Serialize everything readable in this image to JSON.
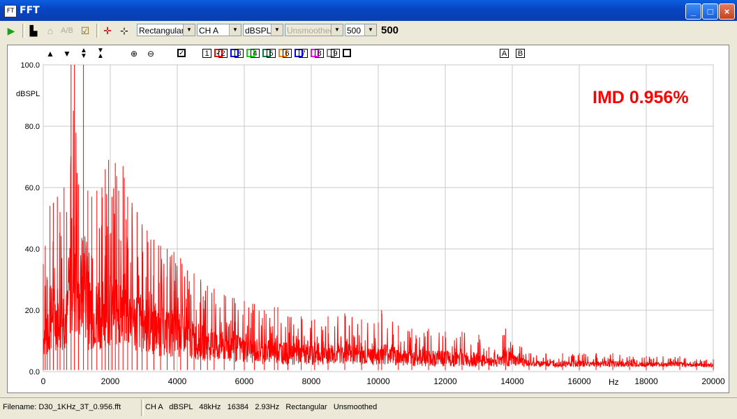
{
  "window": {
    "title": "FFT",
    "app_icon": "fft-app-icon"
  },
  "toolbar": {
    "play_icon": "play-icon",
    "window_type": "Rectangular",
    "channel": "CH A",
    "units": "dBSPL",
    "smoothing": "Unsmoothed",
    "averages": "500",
    "averages_display": "500"
  },
  "plot_toolbar": {
    "trace_numbers": [
      "1",
      "2",
      "3",
      "4",
      "5",
      "6",
      "7",
      "8",
      "9"
    ],
    "trace_colors": [
      "#ff0000",
      "#0000ff",
      "#00e000",
      "#008040",
      "#ff8000",
      "#0000ff",
      "#ff00ff",
      "#808080",
      "#000000"
    ],
    "trace1_checked": true,
    "letters": [
      "A",
      "B"
    ]
  },
  "chart_data": {
    "type": "line",
    "annotation": "IMD 0.956%",
    "annotation_color": "#ff0000",
    "series_color": "#ff0000",
    "ylabel": "dBSPL",
    "xlabel": "Hz",
    "xlim": [
      0,
      20000
    ],
    "ylim": [
      0,
      100
    ],
    "xticks": [
      "0",
      "2000",
      "4000",
      "6000",
      "8000",
      "10000",
      "12000",
      "14000",
      "16000",
      "18000",
      "20000"
    ],
    "xtick_values": [
      0,
      2000,
      4000,
      6000,
      8000,
      10000,
      12000,
      14000,
      16000,
      18000,
      20000
    ],
    "yticks": [
      "0.0",
      "20.0",
      "40.0",
      "60.0",
      "80.0",
      "100.0"
    ],
    "ytick_values": [
      0,
      20,
      40,
      60,
      80,
      100
    ],
    "grid": true,
    "peaks": [
      {
        "x": 0,
        "y": 35
      },
      {
        "x": 60,
        "y": 41
      },
      {
        "x": 120,
        "y": 30
      },
      {
        "x": 200,
        "y": 54
      },
      {
        "x": 300,
        "y": 55
      },
      {
        "x": 420,
        "y": 57
      },
      {
        "x": 500,
        "y": 52
      },
      {
        "x": 620,
        "y": 60
      },
      {
        "x": 700,
        "y": 52
      },
      {
        "x": 830,
        "y": 100
      },
      {
        "x": 930,
        "y": 100
      },
      {
        "x": 1050,
        "y": 61
      },
      {
        "x": 1200,
        "y": 100
      },
      {
        "x": 1330,
        "y": 59
      },
      {
        "x": 1450,
        "y": 57
      },
      {
        "x": 1600,
        "y": 59
      },
      {
        "x": 1750,
        "y": 60
      },
      {
        "x": 1850,
        "y": 66
      },
      {
        "x": 1950,
        "y": 69
      },
      {
        "x": 2050,
        "y": 57
      },
      {
        "x": 2150,
        "y": 68
      },
      {
        "x": 2250,
        "y": 59
      },
      {
        "x": 2380,
        "y": 67
      },
      {
        "x": 2520,
        "y": 57
      },
      {
        "x": 2650,
        "y": 55
      },
      {
        "x": 2800,
        "y": 52
      },
      {
        "x": 2950,
        "y": 48
      },
      {
        "x": 3100,
        "y": 46
      },
      {
        "x": 3300,
        "y": 43
      },
      {
        "x": 3500,
        "y": 41
      },
      {
        "x": 3700,
        "y": 40
      },
      {
        "x": 3900,
        "y": 39
      },
      {
        "x": 4100,
        "y": 37
      },
      {
        "x": 4300,
        "y": 33
      },
      {
        "x": 4500,
        "y": 32
      },
      {
        "x": 4700,
        "y": 30
      },
      {
        "x": 4900,
        "y": 28
      },
      {
        "x": 5100,
        "y": 27
      },
      {
        "x": 5400,
        "y": 25
      },
      {
        "x": 5700,
        "y": 24
      },
      {
        "x": 6000,
        "y": 23
      },
      {
        "x": 6300,
        "y": 22
      },
      {
        "x": 6600,
        "y": 20
      },
      {
        "x": 6900,
        "y": 21
      },
      {
        "x": 7000,
        "y": 21
      },
      {
        "x": 7300,
        "y": 18
      },
      {
        "x": 7700,
        "y": 18
      },
      {
        "x": 8100,
        "y": 17
      },
      {
        "x": 8500,
        "y": 18
      },
      {
        "x": 9000,
        "y": 19
      },
      {
        "x": 9500,
        "y": 17
      },
      {
        "x": 10000,
        "y": 16
      },
      {
        "x": 10100,
        "y": 20
      },
      {
        "x": 10600,
        "y": 15
      },
      {
        "x": 11000,
        "y": 14
      },
      {
        "x": 11500,
        "y": 14
      },
      {
        "x": 12000,
        "y": 13
      },
      {
        "x": 12500,
        "y": 13
      },
      {
        "x": 13000,
        "y": 12
      },
      {
        "x": 13300,
        "y": 8
      },
      {
        "x": 13800,
        "y": 14
      },
      {
        "x": 14500,
        "y": 6
      },
      {
        "x": 15000,
        "y": 6
      },
      {
        "x": 15500,
        "y": 6
      },
      {
        "x": 16000,
        "y": 6
      },
      {
        "x": 16500,
        "y": 6
      },
      {
        "x": 17000,
        "y": 6
      },
      {
        "x": 17500,
        "y": 5
      },
      {
        "x": 18000,
        "y": 5
      },
      {
        "x": 18500,
        "y": 5
      },
      {
        "x": 19000,
        "y": 5
      },
      {
        "x": 19500,
        "y": 4
      },
      {
        "x": 20000,
        "y": 4
      }
    ]
  },
  "status": {
    "filename": "Filename: D30_1KHz_3T_0.956.fft",
    "info": "CH A   dBSPL   48kHz   16384   2.93Hz   Rectangular   Unsmoothed"
  }
}
